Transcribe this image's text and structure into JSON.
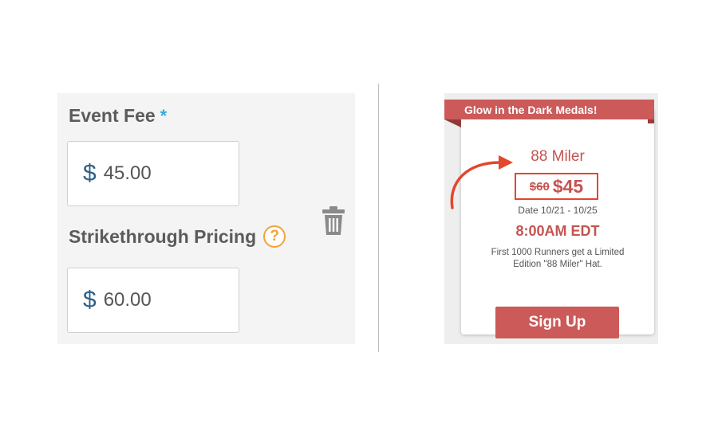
{
  "form": {
    "event_fee": {
      "label": "Event Fee",
      "required_marker": "*",
      "currency_symbol": "$",
      "value": "45.00"
    },
    "strikethrough": {
      "label": "Strikethrough Pricing",
      "help_glyph": "?",
      "currency_symbol": "$",
      "value": "60.00"
    },
    "delete_icon": "trash-icon"
  },
  "card": {
    "ribbon": "Glow in the Dark Medals!",
    "title": "88 Miler",
    "price_old": "$60",
    "price_new": "$45",
    "date": "Date 10/21 - 10/25",
    "time": "8:00AM EDT",
    "description": "First 1000 Runners get a Limited Edition \"88 Miler\" Hat.",
    "signup_label": "Sign Up"
  },
  "colors": {
    "accent_red": "#cb5a59",
    "highlight_box": "#e3472e",
    "arrow": "#e3472e",
    "help_orange": "#f2a33a",
    "required_blue": "#35a9e0",
    "currency_blue": "#2f5f86"
  }
}
